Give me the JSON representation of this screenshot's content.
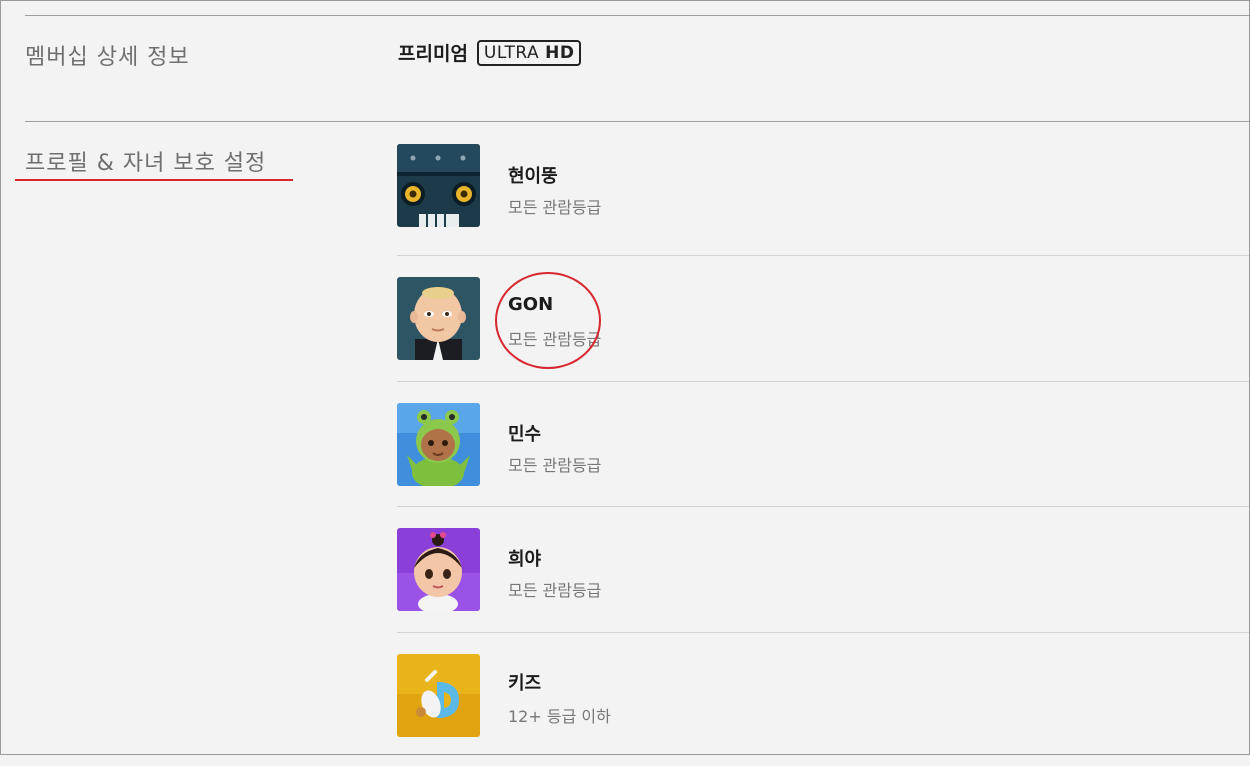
{
  "membership": {
    "label": "멤버십 상세 정보",
    "plan_name": "프리미엄",
    "badge_ultra": "ULTRA",
    "badge_hd": "HD"
  },
  "profiles_section": {
    "label": "프로필 & 자녀 보호 설정",
    "accent_color": "#d7262e",
    "profiles": [
      {
        "name": "현이뚱",
        "rating": "모든 관람등급",
        "avatar": "robot-avatar-icon"
      },
      {
        "name": "GON",
        "rating": "모든 관람등급",
        "avatar": "baby-boss-avatar-icon"
      },
      {
        "name": "민수",
        "rating": "모든 관람등급",
        "avatar": "frog-baby-avatar-icon"
      },
      {
        "name": "희야",
        "rating": "모든 관람등급",
        "avatar": "baby-girl-avatar-icon"
      },
      {
        "name": "키즈",
        "rating": "12+ 등급 이하",
        "avatar": "kids-avatar-icon"
      }
    ]
  }
}
